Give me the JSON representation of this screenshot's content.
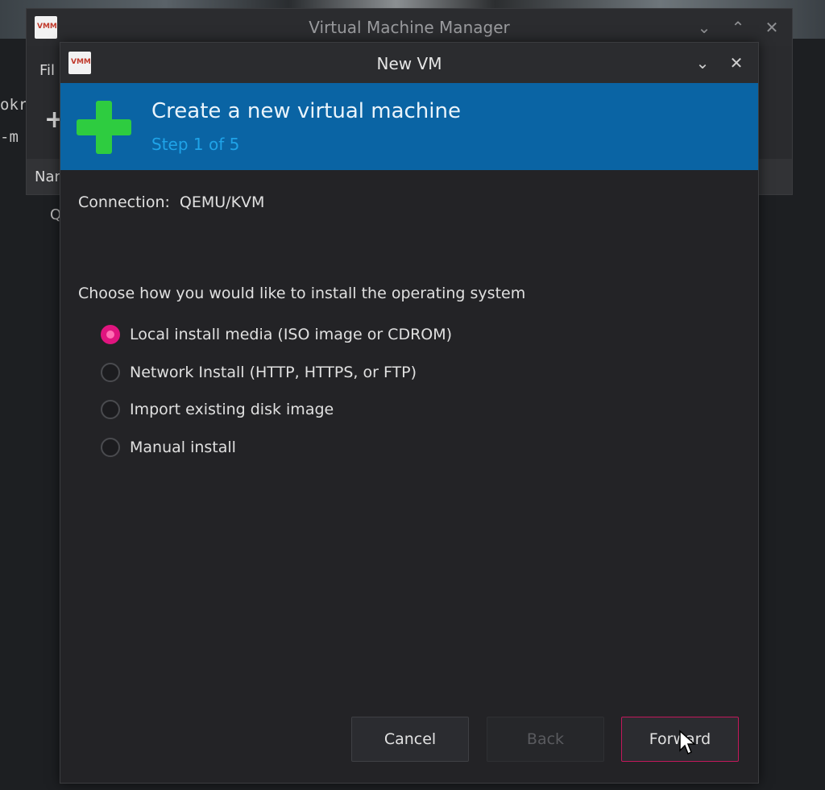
{
  "main_window": {
    "title": "Virtual Machine Manager",
    "menu_partial": "Fil",
    "header_partial": "Nar",
    "row_partial": "Q"
  },
  "desktop": {
    "line1": "okr",
    "line2": "-m"
  },
  "app_icon_text": "VMM",
  "dialog": {
    "title": "New VM",
    "banner_title": "Create a new virtual machine",
    "banner_step": "Step 1 of 5",
    "connection_label": "Connection:",
    "connection_value": "QEMU/KVM",
    "prompt": "Choose how you would like to install the operating system",
    "options": [
      {
        "label": "Local install media (ISO image or CDROM)",
        "selected": true
      },
      {
        "label": "Network Install (HTTP, HTTPS, or FTP)",
        "selected": false
      },
      {
        "label": "Import existing disk image",
        "selected": false
      },
      {
        "label": "Manual install",
        "selected": false
      }
    ],
    "buttons": {
      "cancel": "Cancel",
      "back": "Back",
      "forward": "Forward"
    }
  },
  "colors": {
    "banner": "#0a64a4",
    "accent": "#e0157f",
    "plus_icon": "#2ecc40"
  }
}
